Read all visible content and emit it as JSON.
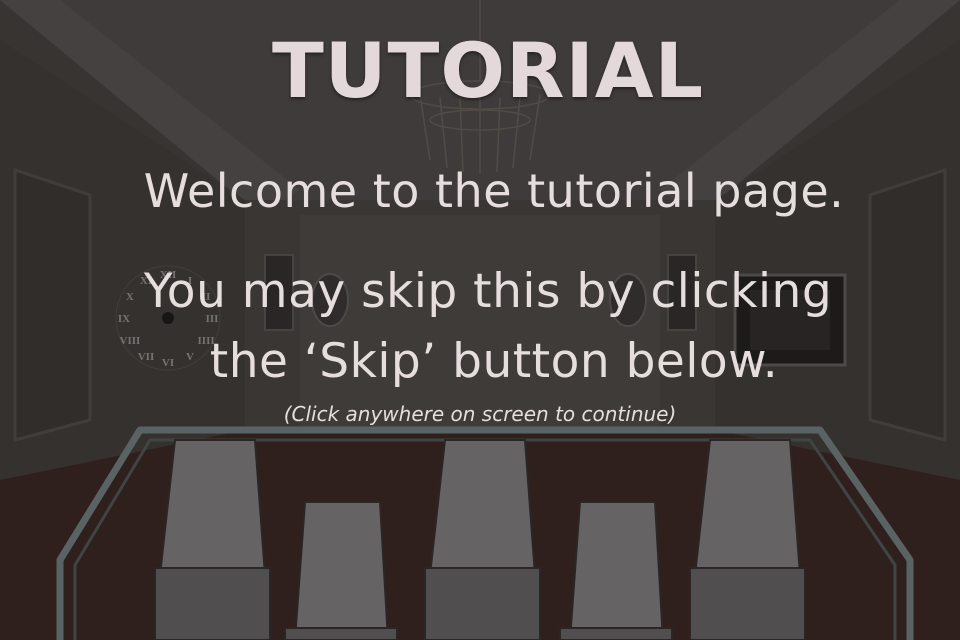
{
  "screen": {
    "title": "TUTORIAL",
    "welcome": "Welcome to the tutorial page.",
    "skip_line1": "You may skip this by clicking",
    "skip_line2": "the ‘Skip’ button below.",
    "hint": "(Click anywhere on screen to continue)"
  },
  "clock": {
    "numerals": [
      "XII",
      "I",
      "II",
      "III",
      "IIII",
      "V",
      "VI",
      "VII",
      "VIII",
      "IX",
      "X",
      "XI"
    ]
  },
  "colors": {
    "text": "#e6dddd",
    "overlay": "#141211",
    "wall": "#5d5854",
    "floor": "#4a2e28",
    "chair": "#b9b5b6",
    "railing": "#9fb4b4"
  }
}
